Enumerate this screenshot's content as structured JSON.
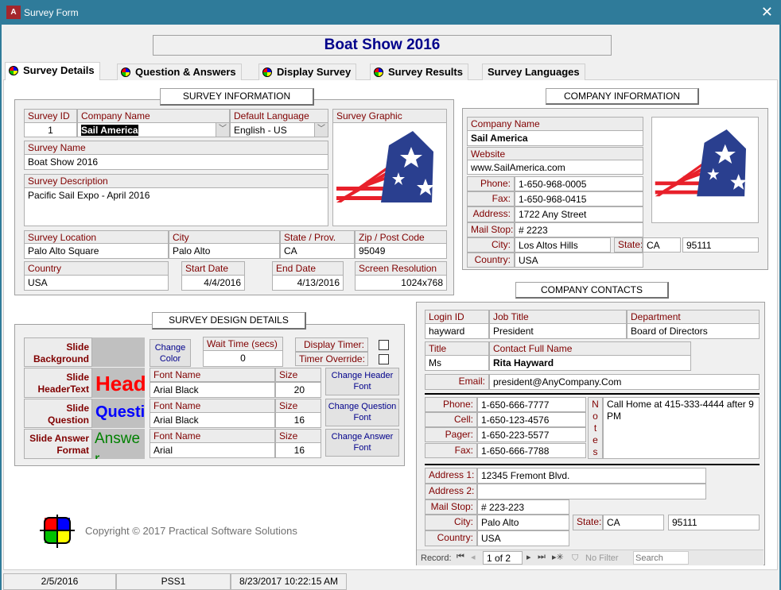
{
  "window": {
    "title": "Survey Form",
    "app_icon": "A",
    "close": "✕"
  },
  "header_title": "Boat Show 2016",
  "tabs": [
    {
      "label": "Survey Details"
    },
    {
      "label": "Question & Answers"
    },
    {
      "label": "Display Survey"
    },
    {
      "label": "Survey Results"
    },
    {
      "label": "Survey Languages"
    }
  ],
  "survey_info": {
    "heading": "SURVEY INFORMATION",
    "survey_id_label": "Survey ID",
    "survey_id": "1",
    "company_name_label": "Company Name",
    "company_name": "Sail America",
    "default_language_label": "Default Language",
    "default_language": "English - US",
    "graphic_label": "Survey Graphic",
    "survey_name_label": "Survey Name",
    "survey_name": "Boat Show 2016",
    "description_label": "Survey Description",
    "description": "Pacific Sail Expo - April 2016",
    "location_label": "Survey Location",
    "location": "Palo Alto Square",
    "city_label": "City",
    "city": "Palo Alto",
    "state_label": "State / Prov.",
    "state": "CA",
    "zip_label": "Zip / Post Code",
    "zip": "95049",
    "country_label": "Country",
    "country": "USA",
    "start_label": "Start Date",
    "start": "4/4/2016",
    "end_label": "End Date",
    "end": "4/13/2016",
    "res_label": "Screen Resolution",
    "res": "1024x768"
  },
  "company_info": {
    "heading": "COMPANY INFORMATION",
    "name_label": "Company Name",
    "name": "Sail America",
    "website_label": "Website",
    "website": "www.SailAmerica.com",
    "phone_label": "Phone:",
    "phone": "1-650-968-0005",
    "fax_label": "Fax:",
    "fax": "1-650-968-0415",
    "address_label": "Address:",
    "address": "1722 Any Street",
    "mailstop_label": "Mail Stop:",
    "mailstop": "# 2223",
    "city_label": "City:",
    "city": "Los Altos Hills",
    "state_label": "State:",
    "state": "CA",
    "zip": "95111",
    "country_label": "Country:",
    "country": "USA"
  },
  "contacts": {
    "heading": "COMPANY CONTACTS",
    "login_label": "Login ID",
    "login": "hayward",
    "job_label": "Job Title",
    "job": "President",
    "dept_label": "Department",
    "dept": "Board of Directors",
    "title_label": "Title",
    "title": "Ms",
    "fullname_label": "Contact Full Name",
    "fullname": "Rita Hayward",
    "email_label": "Email:",
    "email": "president@AnyCompany.Com",
    "phone_label": "Phone:",
    "phone": "1-650-666-7777",
    "cell_label": "Cell:",
    "cell": "1-650-123-4576",
    "pager_label": "Pager:",
    "pager": "1-650-223-5577",
    "fax_label": "Fax:",
    "fax": "1-650-666-7788",
    "notes_label": [
      "N",
      "o",
      "t",
      "e",
      "s"
    ],
    "notes": "Call Home at 415-333-4444 after 9 PM",
    "addr1_label": "Address 1:",
    "addr1": "12345 Fremont Blvd.",
    "addr2_label": "Address 2:",
    "addr2": "",
    "mailstop_label": "Mail Stop:",
    "mailstop": "# 223-223",
    "city_label": "City:",
    "city": "Palo Alto",
    "state_label": "State:",
    "state": "CA",
    "zip": "95111",
    "country_label": "Country:",
    "country": "USA"
  },
  "nav": {
    "record_label": "Record:",
    "current": "1 of 2",
    "filter": "No Filter",
    "search_placeholder": "Search"
  },
  "design": {
    "heading": "SURVEY DESIGN DETAILS",
    "bg_label": "Slide Background",
    "header_label": "Slide HeaderText",
    "question_label": "Slide Question",
    "answer_label": "Slide Answer Format",
    "header_preview": "Header",
    "question_preview": "Question",
    "answer_preview": "Answer",
    "change_color": "Change Color",
    "wait_label": "Wait Time (secs)",
    "wait": "0",
    "display_timer_label": "Display Timer:",
    "timer_override_label": "Timer Override:",
    "display_timer": false,
    "timer_override": false,
    "font_name_label": "Font Name",
    "size_label": "Size",
    "header_font": "Arial Black",
    "header_size": "20",
    "question_font": "Arial Black",
    "question_size": "16",
    "answer_font": "Arial",
    "answer_size": "16",
    "change_header_font": "Change Header Font",
    "change_question_font": "Change Question Font",
    "change_answer_font": "Change Answer Font",
    "colors": {
      "header": "#ff0000",
      "question": "#0000ff",
      "answer": "#008000"
    }
  },
  "copyright": "Copyright © 2017 Practical Software Solutions",
  "status": [
    "2/5/2016",
    "PSS1",
    "8/23/2017 10:22:15 AM"
  ]
}
